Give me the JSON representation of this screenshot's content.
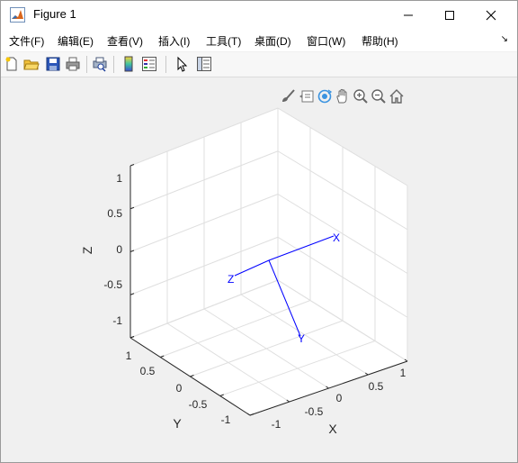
{
  "window": {
    "title": "Figure 1",
    "controls": {
      "minimize": "—",
      "maximize": "☐",
      "close": "✕"
    }
  },
  "menu": {
    "items": [
      "文件(F)",
      "编辑(E)",
      "查看(V)",
      "插入(I)",
      "工具(T)",
      "桌面(D)",
      "窗口(W)",
      "帮助(H)"
    ],
    "overflow_arrow": "↘"
  },
  "toolbar": {
    "buttons": [
      "new-figure",
      "open-file",
      "save",
      "print",
      "print-preview",
      "insert-colorbar",
      "insert-legend",
      "edit-plot",
      "property-inspector"
    ]
  },
  "axes_toolbar": {
    "buttons": [
      "brush",
      "data-tips",
      "rotate-3d",
      "pan",
      "zoom-in",
      "zoom-out",
      "restore-view"
    ]
  },
  "plot": {
    "zlabel": "Z",
    "xlabel": "X",
    "ylabel": "Y",
    "z_ticks": [
      "1",
      "0.5",
      "0",
      "-0.5",
      "-1"
    ],
    "x_ticks": [
      "-1",
      "-0.5",
      "0",
      "0.5",
      "1"
    ],
    "y_ticks": [
      "1",
      "0.5",
      "0",
      "-0.5",
      "-1"
    ],
    "vector_labels": {
      "x": "X",
      "y": "Y",
      "z": "Z"
    },
    "line_color": "#0000ff",
    "grid_color": "#dfdfdf",
    "axis_color": "#262626"
  }
}
